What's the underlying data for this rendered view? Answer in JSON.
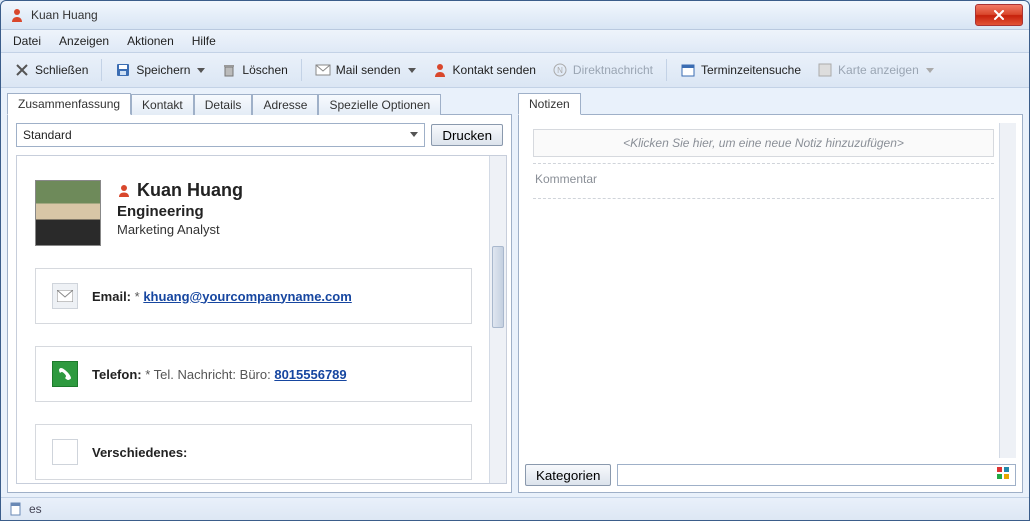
{
  "window": {
    "title": "Kuan Huang"
  },
  "menu": {
    "datei": "Datei",
    "anzeigen": "Anzeigen",
    "aktionen": "Aktionen",
    "hilfe": "Hilfe"
  },
  "toolbar": {
    "schliessen": "Schließen",
    "speichern": "Speichern",
    "loeschen": "Löschen",
    "mail": "Mail senden",
    "kontakt": "Kontakt senden",
    "direkt": "Direktnachricht",
    "termin": "Terminzeitensuche",
    "karte": "Karte anzeigen"
  },
  "tabs_left": {
    "zusammenfassung": "Zusammenfassung",
    "kontakt": "Kontakt",
    "details": "Details",
    "adresse": "Adresse",
    "speziell": "Spezielle Optionen"
  },
  "tabs_right": {
    "notizen": "Notizen"
  },
  "left": {
    "view_selector": "Standard",
    "drucken": "Drucken",
    "person": {
      "name": "Kuan Huang",
      "department": "Engineering",
      "role": "Marketing Analyst"
    },
    "email": {
      "label": "Email:",
      "req": "*",
      "value": "khuang@yourcompanyname.com"
    },
    "phone": {
      "label": "Telefon:",
      "req": "*",
      "hint": "Tel. Nachricht: Büro:",
      "value": "8015556789"
    },
    "misc": {
      "label": "Verschiedenes:"
    }
  },
  "right": {
    "add_note_placeholder": "<Klicken Sie hier, um eine neue Notiz hinzuzufügen>",
    "kommentar": "Kommentar",
    "kategorien": "Kategorien"
  },
  "status": {
    "text": "es"
  }
}
